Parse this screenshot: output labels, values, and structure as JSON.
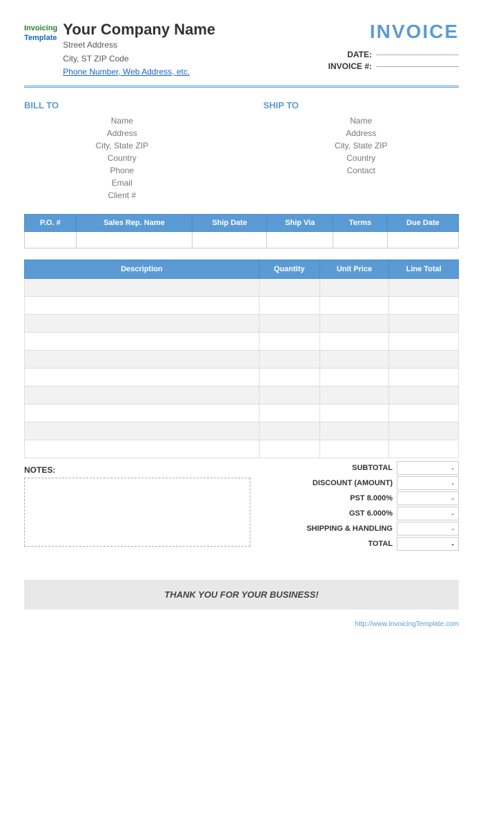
{
  "header": {
    "company_name": "Your Company Name",
    "street_address": "Street Address",
    "city_state_zip": "City, ST  ZIP Code",
    "phone_web": "Phone Number, Web Address, etc.",
    "invoice_title": "INVOICE",
    "date_label": "DATE:",
    "date_value": "",
    "invoice_num_label": "INVOICE #:",
    "invoice_num_value": "",
    "logo_invoicing": "Invoicing",
    "logo_template": "Template"
  },
  "bill_to": {
    "title": "BILL TO",
    "name": "Name",
    "address": "Address",
    "city_state_zip": "City, State ZIP",
    "country": "Country",
    "phone": "Phone",
    "email": "Email",
    "client": "Client #"
  },
  "ship_to": {
    "title": "SHIP TO",
    "name": "Name",
    "address": "Address",
    "city_state_zip": "City, State ZIP",
    "country": "Country",
    "contact": "Contact"
  },
  "order_table": {
    "columns": [
      "P.O. #",
      "Sales Rep. Name",
      "Ship Date",
      "Ship Via",
      "Terms",
      "Due Date"
    ],
    "row": [
      "",
      "",
      "",
      "",
      "",
      ""
    ]
  },
  "items_table": {
    "columns": [
      "Description",
      "Quantity",
      "Unit Price",
      "Line Total"
    ],
    "rows": [
      [
        "",
        "",
        "",
        ""
      ],
      [
        "",
        "",
        "",
        ""
      ],
      [
        "",
        "",
        "",
        ""
      ],
      [
        "",
        "",
        "",
        ""
      ],
      [
        "",
        "",
        "",
        ""
      ],
      [
        "",
        "",
        "",
        ""
      ],
      [
        "",
        "",
        "",
        ""
      ],
      [
        "",
        "",
        "",
        ""
      ],
      [
        "",
        "",
        "",
        ""
      ],
      [
        "",
        "",
        "",
        ""
      ]
    ]
  },
  "totals": {
    "subtotal_label": "SUBTOTAL",
    "subtotal_value": "-",
    "discount_label": "DISCOUNT (AMOUNT)",
    "discount_value": "-",
    "pst_label": "PST",
    "pst_rate": "8.000%",
    "pst_value": "-",
    "gst_label": "GST",
    "gst_rate": "6.000%",
    "gst_value": "-",
    "shipping_label": "SHIPPING & HANDLING",
    "shipping_value": "-",
    "total_label": "TOTAL",
    "total_value": "-"
  },
  "notes": {
    "label": "NOTES:"
  },
  "footer": {
    "thank_you": "THANK YOU FOR YOUR BUSINESS!",
    "watermark": "http://www.InvoicingTemplate.com"
  }
}
